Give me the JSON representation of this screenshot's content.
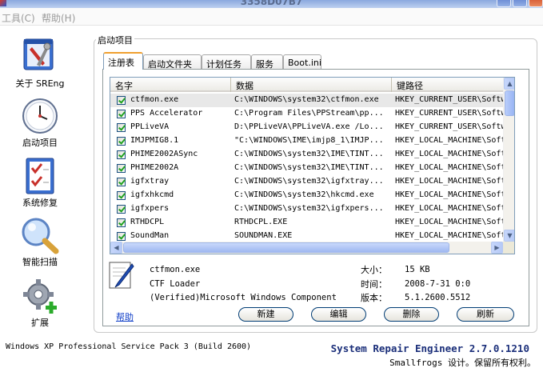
{
  "window": {
    "title": "3358D07B7"
  },
  "menu": [
    {
      "label": "工具(C)"
    },
    {
      "label": "帮助(H)"
    }
  ],
  "nav": [
    {
      "label": "关于 SREng"
    },
    {
      "label": "启动项目"
    },
    {
      "label": "系统修复"
    },
    {
      "label": "智能扫描"
    },
    {
      "label": "扩展"
    }
  ],
  "group_title": "启动项目",
  "tabs": [
    {
      "label": "注册表",
      "active": true
    },
    {
      "label": "启动文件夹"
    },
    {
      "label": "计划任务"
    },
    {
      "label": "服务"
    },
    {
      "label": "Boot.ini"
    }
  ],
  "table": {
    "columns": [
      "名字",
      "数据",
      "键路径"
    ],
    "rows": [
      {
        "name": "ctfmon.exe",
        "data": "C:\\WINDOWS\\system32\\ctfmon.exe",
        "path": "HKEY_CURRENT_USER\\Softw",
        "checked": true,
        "selected": true
      },
      {
        "name": "PPS Accelerator",
        "data": "C:\\Program Files\\PPStream\\pp...",
        "path": "HKEY_CURRENT_USER\\Softw",
        "checked": true
      },
      {
        "name": "PPLiveVA",
        "data": "D:\\PPLiveVA\\PPLiveVA.exe /Lo...",
        "path": "HKEY_CURRENT_USER\\Softw",
        "checked": true
      },
      {
        "name": "IMJPMIG8.1",
        "data": "\"C:\\WINDOWS\\IME\\imjp8_1\\IMJP...",
        "path": "HKEY_LOCAL_MACHINE\\Soft",
        "checked": true
      },
      {
        "name": "PHIME2002ASync",
        "data": "C:\\WINDOWS\\system32\\IME\\TINT...",
        "path": "HKEY_LOCAL_MACHINE\\Soft",
        "checked": true
      },
      {
        "name": "PHIME2002A",
        "data": "C:\\WINDOWS\\system32\\IME\\TINT...",
        "path": "HKEY_LOCAL_MACHINE\\Soft",
        "checked": true
      },
      {
        "name": "igfxtray",
        "data": "C:\\WINDOWS\\system32\\igfxtray...",
        "path": "HKEY_LOCAL_MACHINE\\Soft",
        "checked": true
      },
      {
        "name": "igfxhkcmd",
        "data": "C:\\WINDOWS\\system32\\hkcmd.exe",
        "path": "HKEY_LOCAL_MACHINE\\Soft",
        "checked": true
      },
      {
        "name": "igfxpers",
        "data": "C:\\WINDOWS\\system32\\igfxpers...",
        "path": "HKEY_LOCAL_MACHINE\\Soft",
        "checked": true
      },
      {
        "name": "RTHDCPL",
        "data": "RTHDCPL.EXE",
        "path": "HKEY_LOCAL_MACHINE\\Soft",
        "checked": true
      },
      {
        "name": "SoundMan",
        "data": "SOUNDMAN.EXE",
        "path": "HKEY_LOCAL_MACHINE\\Soft",
        "checked": true
      }
    ]
  },
  "details": {
    "filename": "ctfmon.exe",
    "description": "CTF Loader",
    "company": "(Verified)Microsoft Windows Component",
    "size_label": "大小：",
    "size_value": "15 KB",
    "time_label": "时间：",
    "time_value": "2008-7-31 0:0",
    "version_label": "版本：",
    "version_value": "5.1.2600.5512"
  },
  "help_link": "帮助",
  "buttons": {
    "new": "新建",
    "edit": "编辑",
    "delete": "删除",
    "refresh": "刷新"
  },
  "status": {
    "os": "Windows XP Professional Service Pack 3 (Build 2600)",
    "brand": "System Repair Engineer 2.7.0.1210",
    "copyright": "Smallfrogs 设计。保留所有权利。"
  },
  "colors": {
    "accent": "#1b2f7a",
    "link": "#1240c8",
    "tab_highlight": "#f0a030"
  }
}
